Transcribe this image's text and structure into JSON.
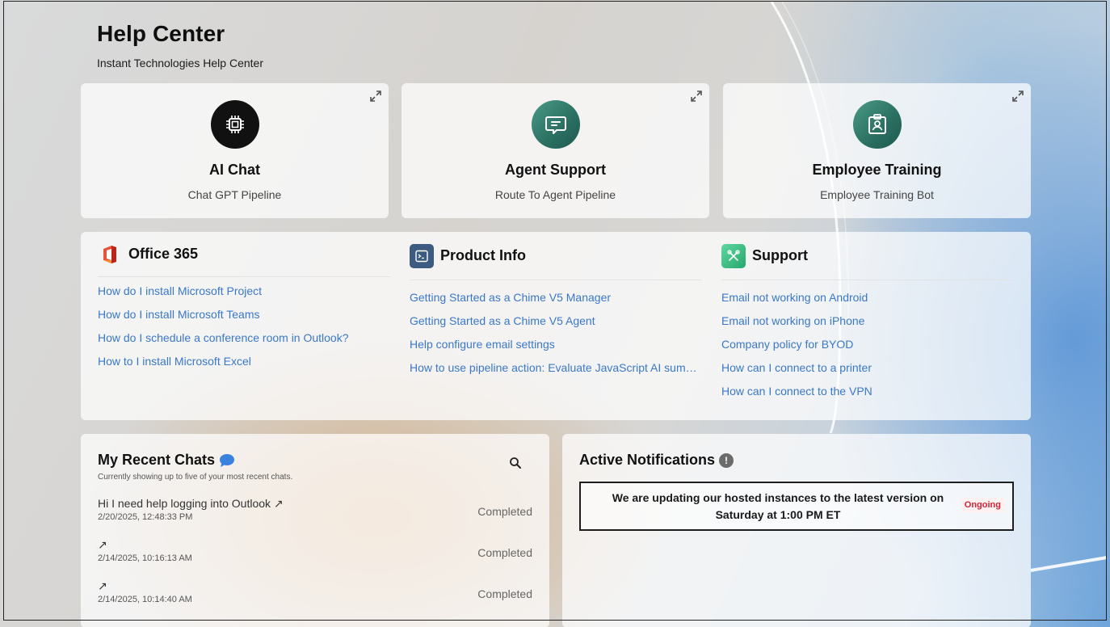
{
  "header": {
    "title": "Help Center",
    "subtitle": "Instant Technologies Help Center"
  },
  "pipelines": [
    {
      "title": "AI Chat",
      "description": "Chat GPT Pipeline",
      "icon": "cpu-chip-icon"
    },
    {
      "title": "Agent Support",
      "description": "Route To Agent Pipeline",
      "icon": "chat-bubble-icon"
    },
    {
      "title": "Employee Training",
      "description": "Employee Training Bot",
      "icon": "id-badge-icon"
    }
  ],
  "knowledge_base": {
    "office": {
      "title": "Office 365",
      "icon": "office-365-logo-icon",
      "links": [
        "How do I install Microsoft Project",
        "How do I install Microsoft Teams",
        "How do I schedule a conference room in Outlook?",
        "How to I install Microsoft Excel"
      ]
    },
    "product": {
      "title": "Product Info",
      "icon": "terminal-icon",
      "links": [
        "Getting Started as a Chime V5 Manager",
        "Getting Started as a Chime V5 Agent",
        "Help configure email settings",
        "How to use pipeline action: Evaluate JavaScript AI summary"
      ]
    },
    "support": {
      "title": "Support",
      "icon": "tools-icon",
      "links": [
        "Email not working on Android",
        "Email not working on iPhone",
        "Company policy for BYOD",
        "How can I connect to a printer",
        "How can I connect to the VPN"
      ]
    }
  },
  "recent_chats": {
    "title": "My Recent Chats",
    "hint": "Currently showing up to five of your most recent chats.",
    "items": [
      {
        "message": "Hi I need help logging into Outlook ↗",
        "time": "2/20/2025, 12:48:33 PM",
        "status": "Completed"
      },
      {
        "message": "↗",
        "time": "2/14/2025, 10:16:13 AM",
        "status": "Completed"
      },
      {
        "message": "↗",
        "time": "2/14/2025, 10:14:40 AM",
        "status": "Completed"
      }
    ]
  },
  "notifications": {
    "title": "Active Notifications",
    "info_glyph": "!",
    "items": [
      {
        "text": "We are updating our hosted instances to the latest version on Saturday at 1:00 PM ET",
        "status": "Ongoing"
      }
    ]
  },
  "colors": {
    "link": "#3a78c7",
    "teal": "#2a6f61",
    "ongoing": "#d0263a",
    "chat_icon": "#3b82e0"
  }
}
